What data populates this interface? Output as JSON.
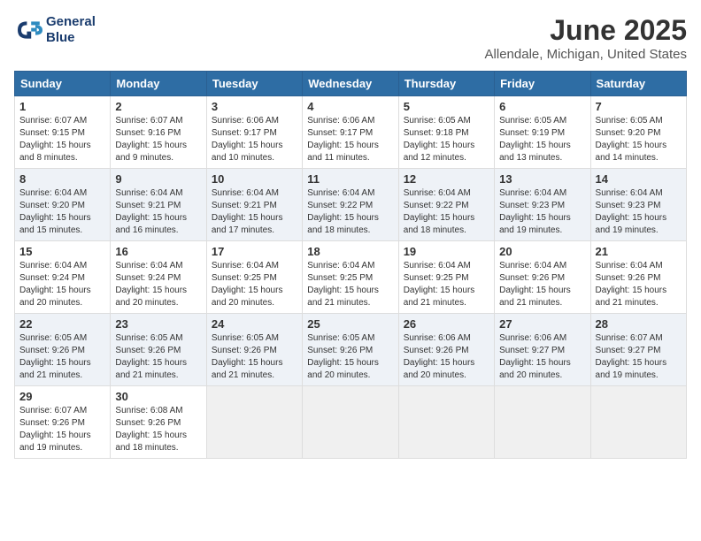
{
  "app": {
    "logo_line1": "General",
    "logo_line2": "Blue"
  },
  "title": "June 2025",
  "subtitle": "Allendale, Michigan, United States",
  "headers": [
    "Sunday",
    "Monday",
    "Tuesday",
    "Wednesday",
    "Thursday",
    "Friday",
    "Saturday"
  ],
  "weeks": [
    [
      {
        "day": "1",
        "info": "Sunrise: 6:07 AM\nSunset: 9:15 PM\nDaylight: 15 hours\nand 8 minutes."
      },
      {
        "day": "2",
        "info": "Sunrise: 6:07 AM\nSunset: 9:16 PM\nDaylight: 15 hours\nand 9 minutes."
      },
      {
        "day": "3",
        "info": "Sunrise: 6:06 AM\nSunset: 9:17 PM\nDaylight: 15 hours\nand 10 minutes."
      },
      {
        "day": "4",
        "info": "Sunrise: 6:06 AM\nSunset: 9:17 PM\nDaylight: 15 hours\nand 11 minutes."
      },
      {
        "day": "5",
        "info": "Sunrise: 6:05 AM\nSunset: 9:18 PM\nDaylight: 15 hours\nand 12 minutes."
      },
      {
        "day": "6",
        "info": "Sunrise: 6:05 AM\nSunset: 9:19 PM\nDaylight: 15 hours\nand 13 minutes."
      },
      {
        "day": "7",
        "info": "Sunrise: 6:05 AM\nSunset: 9:20 PM\nDaylight: 15 hours\nand 14 minutes."
      }
    ],
    [
      {
        "day": "8",
        "info": "Sunrise: 6:04 AM\nSunset: 9:20 PM\nDaylight: 15 hours\nand 15 minutes."
      },
      {
        "day": "9",
        "info": "Sunrise: 6:04 AM\nSunset: 9:21 PM\nDaylight: 15 hours\nand 16 minutes."
      },
      {
        "day": "10",
        "info": "Sunrise: 6:04 AM\nSunset: 9:21 PM\nDaylight: 15 hours\nand 17 minutes."
      },
      {
        "day": "11",
        "info": "Sunrise: 6:04 AM\nSunset: 9:22 PM\nDaylight: 15 hours\nand 18 minutes."
      },
      {
        "day": "12",
        "info": "Sunrise: 6:04 AM\nSunset: 9:22 PM\nDaylight: 15 hours\nand 18 minutes."
      },
      {
        "day": "13",
        "info": "Sunrise: 6:04 AM\nSunset: 9:23 PM\nDaylight: 15 hours\nand 19 minutes."
      },
      {
        "day": "14",
        "info": "Sunrise: 6:04 AM\nSunset: 9:23 PM\nDaylight: 15 hours\nand 19 minutes."
      }
    ],
    [
      {
        "day": "15",
        "info": "Sunrise: 6:04 AM\nSunset: 9:24 PM\nDaylight: 15 hours\nand 20 minutes."
      },
      {
        "day": "16",
        "info": "Sunrise: 6:04 AM\nSunset: 9:24 PM\nDaylight: 15 hours\nand 20 minutes."
      },
      {
        "day": "17",
        "info": "Sunrise: 6:04 AM\nSunset: 9:25 PM\nDaylight: 15 hours\nand 20 minutes."
      },
      {
        "day": "18",
        "info": "Sunrise: 6:04 AM\nSunset: 9:25 PM\nDaylight: 15 hours\nand 21 minutes."
      },
      {
        "day": "19",
        "info": "Sunrise: 6:04 AM\nSunset: 9:25 PM\nDaylight: 15 hours\nand 21 minutes."
      },
      {
        "day": "20",
        "info": "Sunrise: 6:04 AM\nSunset: 9:26 PM\nDaylight: 15 hours\nand 21 minutes."
      },
      {
        "day": "21",
        "info": "Sunrise: 6:04 AM\nSunset: 9:26 PM\nDaylight: 15 hours\nand 21 minutes."
      }
    ],
    [
      {
        "day": "22",
        "info": "Sunrise: 6:05 AM\nSunset: 9:26 PM\nDaylight: 15 hours\nand 21 minutes."
      },
      {
        "day": "23",
        "info": "Sunrise: 6:05 AM\nSunset: 9:26 PM\nDaylight: 15 hours\nand 21 minutes."
      },
      {
        "day": "24",
        "info": "Sunrise: 6:05 AM\nSunset: 9:26 PM\nDaylight: 15 hours\nand 21 minutes."
      },
      {
        "day": "25",
        "info": "Sunrise: 6:05 AM\nSunset: 9:26 PM\nDaylight: 15 hours\nand 20 minutes."
      },
      {
        "day": "26",
        "info": "Sunrise: 6:06 AM\nSunset: 9:26 PM\nDaylight: 15 hours\nand 20 minutes."
      },
      {
        "day": "27",
        "info": "Sunrise: 6:06 AM\nSunset: 9:27 PM\nDaylight: 15 hours\nand 20 minutes."
      },
      {
        "day": "28",
        "info": "Sunrise: 6:07 AM\nSunset: 9:27 PM\nDaylight: 15 hours\nand 19 minutes."
      }
    ],
    [
      {
        "day": "29",
        "info": "Sunrise: 6:07 AM\nSunset: 9:26 PM\nDaylight: 15 hours\nand 19 minutes."
      },
      {
        "day": "30",
        "info": "Sunrise: 6:08 AM\nSunset: 9:26 PM\nDaylight: 15 hours\nand 18 minutes."
      },
      {
        "day": "",
        "info": ""
      },
      {
        "day": "",
        "info": ""
      },
      {
        "day": "",
        "info": ""
      },
      {
        "day": "",
        "info": ""
      },
      {
        "day": "",
        "info": ""
      }
    ]
  ]
}
